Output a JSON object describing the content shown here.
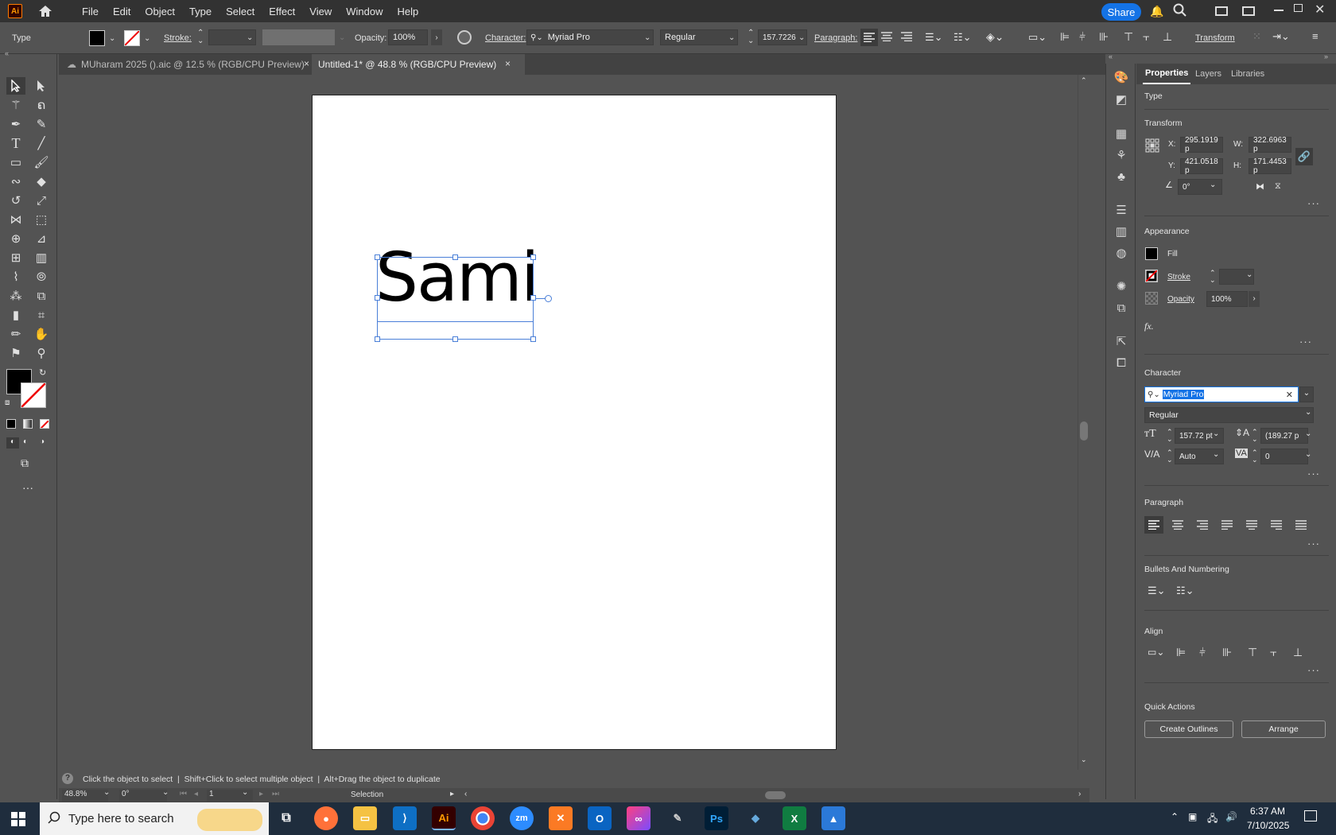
{
  "menubar": {
    "app_icon": "Ai",
    "items": [
      "File",
      "Edit",
      "Object",
      "Type",
      "Select",
      "Effect",
      "View",
      "Window",
      "Help"
    ],
    "share": "Share"
  },
  "control": {
    "mode": "Type",
    "stroke_label": "Stroke:",
    "opacity_label": "Opacity:",
    "opacity_value": "100%",
    "character_label": "Character:",
    "font": "Myriad Pro",
    "style": "Regular",
    "size": "157.7226",
    "paragraph_label": "Paragraph:",
    "transform": "Transform"
  },
  "tabs": [
    {
      "label": "MUharam 2025 ().aic @ 12.5 % (RGB/CPU Preview)"
    },
    {
      "label": "Untitled-1* @ 48.8 % (RGB/CPU Preview)"
    }
  ],
  "tab_close": "×",
  "canvas": {
    "text": "Sami"
  },
  "status": {
    "hint": "Click the object to select  |  Shift+Click to select multiple object  |  Alt+Drag the object to duplicate"
  },
  "bottom": {
    "zoom": "48.8%",
    "rotation": "0°",
    "artboard": "1",
    "tool": "Selection"
  },
  "props": {
    "tabs": [
      "Properties",
      "Layers",
      "Libraries"
    ],
    "type": "Type",
    "transform": {
      "title": "Transform",
      "x_label": "X:",
      "x": "295.1919 p",
      "y_label": "Y:",
      "y": "421.0518 p",
      "w_label": "W:",
      "w": "322.6963 p",
      "h_label": "H:",
      "h": "171.4453 p",
      "angle": "0°"
    },
    "appearance": {
      "title": "Appearance",
      "fill": "Fill",
      "stroke": "Stroke",
      "opacity": "Opacity",
      "opacity_value": "100%",
      "fx": "fx."
    },
    "character": {
      "title": "Character",
      "font": "Myriad Pro",
      "style": "Regular",
      "size": "157.72 pt",
      "leading": "(189.27 p",
      "kerning": "Auto",
      "tracking": "0"
    },
    "paragraph": {
      "title": "Paragraph"
    },
    "bullets": {
      "title": "Bullets And Numbering"
    },
    "align": {
      "title": "Align"
    },
    "quick": {
      "title": "Quick Actions",
      "outlines": "Create Outlines",
      "arrange": "Arrange"
    }
  },
  "taskbar": {
    "search": "Type here to search",
    "time": "6:37 AM",
    "date": "7/10/2025",
    "apps": [
      "Ai",
      "Ps",
      "zm"
    ]
  },
  "colors": {
    "accent": "#1473e6",
    "selection": "#4a7fd8",
    "panel": "#535353",
    "menubar": "#323232"
  }
}
